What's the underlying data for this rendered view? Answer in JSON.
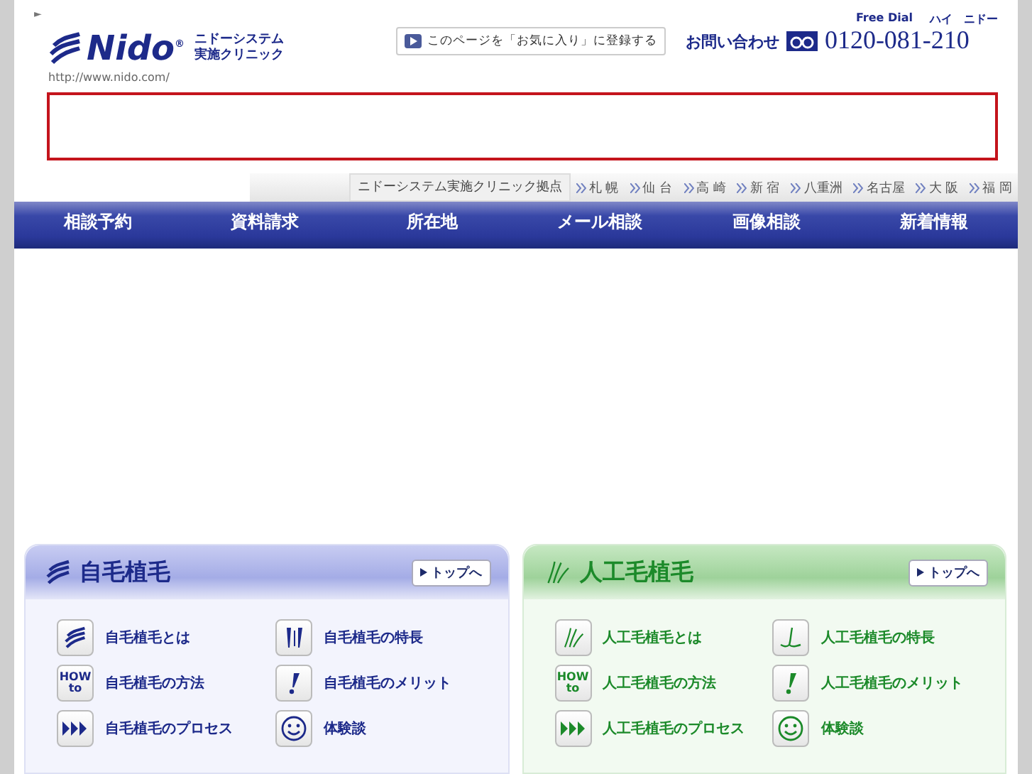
{
  "header": {
    "marker": "►",
    "logo_text": "Nido",
    "logo_mark": "®",
    "clinic_name": [
      "ニドーシステム",
      "実施クリニック"
    ],
    "url": "http://www.nido.com/",
    "favorite_button": "このページを「お気に入り」に登録する",
    "contact_label": "お問い合わせ",
    "free_dial_label": "Free Dial",
    "free_dial_reading": "ハイ　ニドー",
    "phone": "0120-081-210"
  },
  "locations": {
    "title": "ニドーシステム実施クリニック拠点",
    "items": [
      "札 幌",
      "仙 台",
      "高 崎",
      "新 宿",
      "八重洲",
      "名古屋",
      "大 阪",
      "福 岡"
    ]
  },
  "nav": [
    "相談予約",
    "資料請求",
    "所在地",
    "メール相談",
    "画像相談",
    "新着情報"
  ],
  "panels": [
    {
      "kind": "natural",
      "title": "自毛植毛",
      "top_link": "トップへ",
      "items": [
        {
          "kind": "waves",
          "label": "自毛植毛とは"
        },
        {
          "kind": "bars",
          "label": "自毛植毛の特長"
        },
        {
          "kind": "how",
          "label": "自毛植毛の方法",
          "icon_text": [
            "HOW",
            "to"
          ]
        },
        {
          "kind": "exclaim",
          "label": "自毛植毛のメリット"
        },
        {
          "kind": "arrows",
          "label": "自毛植毛のプロセス"
        },
        {
          "kind": "smile",
          "label": "体験談"
        }
      ]
    },
    {
      "kind": "artificial",
      "title": "人工毛植毛",
      "top_link": "トップへ",
      "items": [
        {
          "kind": "strands",
          "label": "人工毛植毛とは"
        },
        {
          "kind": "strand",
          "label": "人工毛植毛の特長"
        },
        {
          "kind": "how",
          "label": "人工毛植毛の方法",
          "icon_text": [
            "HOW",
            "to"
          ]
        },
        {
          "kind": "exclaim",
          "label": "人工毛植毛のメリット"
        },
        {
          "kind": "arrows",
          "label": "人工毛植毛のプロセス"
        },
        {
          "kind": "smile",
          "label": "体験談"
        }
      ]
    }
  ]
}
